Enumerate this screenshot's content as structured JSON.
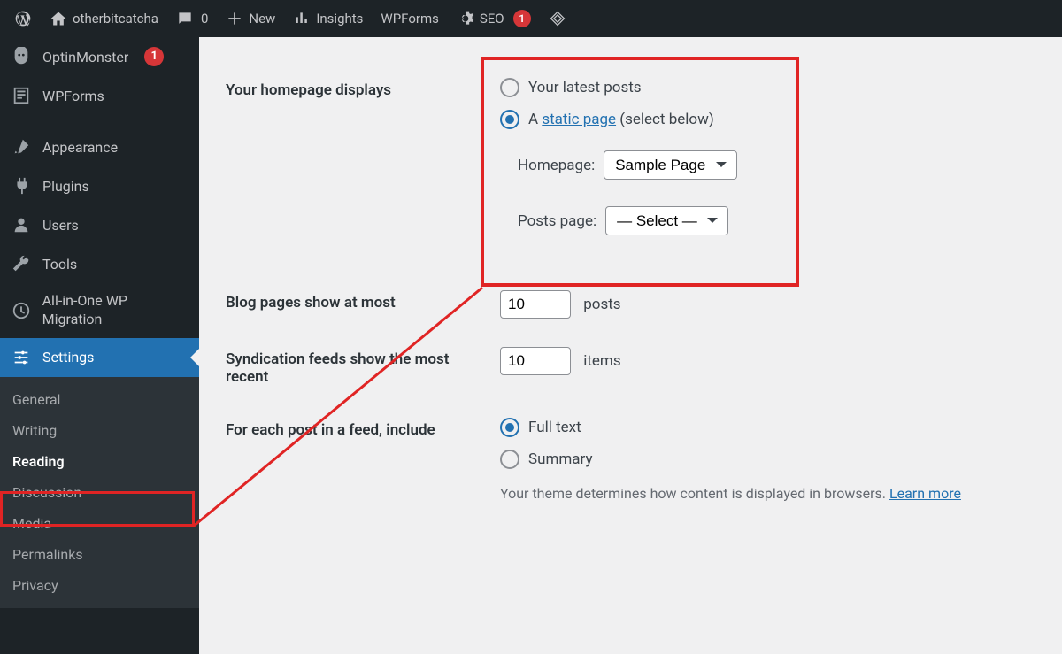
{
  "adminbar": {
    "site_name": "otherbitcatcha",
    "comments_count": "0",
    "new_label": "New",
    "insights_label": "Insights",
    "wpforms_label": "WPForms",
    "seo_label": "SEO",
    "seo_badge": "1"
  },
  "sidebar": {
    "items": [
      {
        "label": "OptinMonster",
        "badge": "1",
        "icon": "monster-icon"
      },
      {
        "label": "WPForms",
        "icon": "wpforms-icon"
      },
      {
        "label": "Appearance",
        "icon": "brush-icon"
      },
      {
        "label": "Plugins",
        "icon": "plug-icon"
      },
      {
        "label": "Users",
        "icon": "user-icon"
      },
      {
        "label": "Tools",
        "icon": "wrench-icon"
      },
      {
        "label": "All-in-One WP Migration",
        "icon": "migration-icon"
      },
      {
        "label": "Settings",
        "icon": "sliders-icon",
        "current": true
      }
    ],
    "settings_sub": [
      {
        "label": "General"
      },
      {
        "label": "Writing"
      },
      {
        "label": "Reading",
        "current": true
      },
      {
        "label": "Discussion"
      },
      {
        "label": "Media"
      },
      {
        "label": "Permalinks"
      },
      {
        "label": "Privacy"
      }
    ]
  },
  "settings": {
    "homepage_displays_label": "Your homepage displays",
    "radio_latest_posts": "Your latest posts",
    "radio_static_prefix": "A ",
    "radio_static_link": "static page",
    "radio_static_suffix": " (select below)",
    "homepage_select_label": "Homepage:",
    "homepage_select_value": "Sample Page",
    "posts_page_select_label": "Posts page:",
    "posts_page_select_value": "— Select —",
    "blog_pages_label": "Blog pages show at most",
    "blog_pages_value": "10",
    "blog_pages_unit": "posts",
    "syndication_label": "Syndication feeds show the most recent",
    "syndication_value": "10",
    "syndication_unit": "items",
    "feed_include_label": "For each post in a feed, include",
    "feed_full_text": "Full text",
    "feed_summary": "Summary",
    "feed_desc": "Your theme determines how content is displayed in browsers. ",
    "feed_learn_more": "Learn more"
  }
}
